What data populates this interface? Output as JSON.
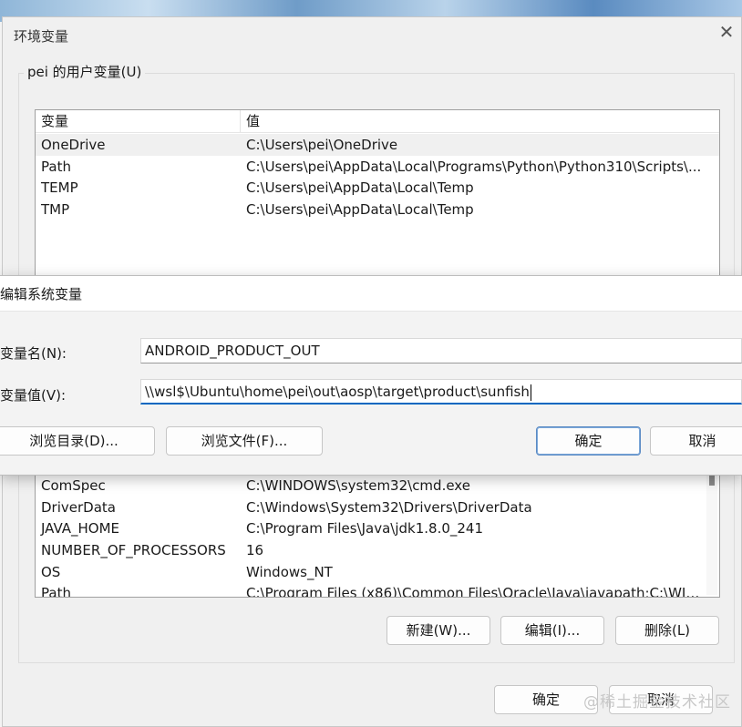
{
  "window": {
    "title": "环境变量"
  },
  "user_vars": {
    "group_label": "pei 的用户变量(U)",
    "columns": [
      "变量",
      "值"
    ],
    "rows": [
      {
        "name": "OneDrive",
        "value": "C:\\Users\\pei\\OneDrive"
      },
      {
        "name": "Path",
        "value": "C:\\Users\\pei\\AppData\\Local\\Programs\\Python\\Python310\\Scripts\\..."
      },
      {
        "name": "TEMP",
        "value": "C:\\Users\\pei\\AppData\\Local\\Temp"
      },
      {
        "name": "TMP",
        "value": "C:\\Users\\pei\\AppData\\Local\\Temp"
      }
    ]
  },
  "system_vars": {
    "rows": [
      {
        "name": "ComSpec",
        "value": "C:\\WINDOWS\\system32\\cmd.exe"
      },
      {
        "name": "DriverData",
        "value": "C:\\Windows\\System32\\Drivers\\DriverData"
      },
      {
        "name": "JAVA_HOME",
        "value": "C:\\Program Files\\Java\\jdk1.8.0_241"
      },
      {
        "name": "NUMBER_OF_PROCESSORS",
        "value": "16"
      },
      {
        "name": "OS",
        "value": "Windows_NT"
      },
      {
        "name": "Path",
        "value": "C:\\Program Files (x86)\\Common Files\\Oracle\\Java\\javapath;C:\\WIN..."
      }
    ],
    "new_label": "新建(W)...",
    "edit_label": "编辑(I)...",
    "delete_label": "删除(L)"
  },
  "footer": {
    "ok_label": "确定",
    "cancel_label": "取消"
  },
  "edit_dialog": {
    "title": "编辑系统变量",
    "name_label": "变量名(N):",
    "name_value": "ANDROID_PRODUCT_OUT",
    "value_label": "变量值(V):",
    "value_value": "\\\\wsl$\\Ubuntu\\home\\pei\\out\\aosp\\target\\product\\sunfish",
    "browse_dir_label": "浏览目录(D)...",
    "browse_file_label": "浏览文件(F)...",
    "ok_label": "确定",
    "cancel_label": "取消"
  },
  "watermark": "@稀土掘金技术社区"
}
